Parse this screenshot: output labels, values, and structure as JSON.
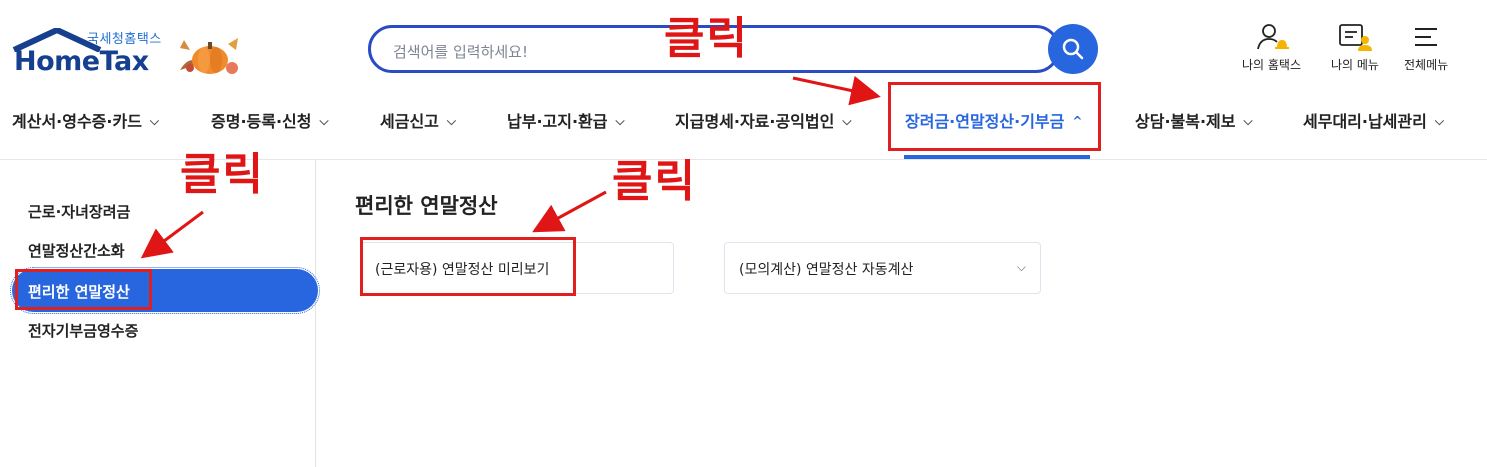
{
  "logo": {
    "sub": "국세청홈택스",
    "main": "HomeTax"
  },
  "search": {
    "placeholder": "검색어를 입력하세요!"
  },
  "util": {
    "my_hometax": "나의 홈택스",
    "my_menu": "나의 메뉴",
    "all_menu": "전체메뉴"
  },
  "nav": {
    "items": [
      {
        "label": "계산서·영수증·카드"
      },
      {
        "label": "증명·등록·신청"
      },
      {
        "label": "세금신고"
      },
      {
        "label": "납부·고지·환급"
      },
      {
        "label": "지급명세·자료·공익법인"
      },
      {
        "label": "장려금·연말정산·기부금"
      },
      {
        "label": "상담·불복·제보"
      },
      {
        "label": "세무대리·납세관리"
      }
    ],
    "chev_down": "⌵",
    "chev_up": "^"
  },
  "sidebar": {
    "items": [
      {
        "label": "근로·자녀장려금"
      },
      {
        "label": "연말정산간소화"
      },
      {
        "label": "편리한 연말정산"
      },
      {
        "label": "전자기부금영수증"
      }
    ]
  },
  "main": {
    "title": "편리한 연말정산",
    "cards": [
      {
        "label": "(근로자용) 연말정산 미리보기"
      },
      {
        "label": "(모의계산) 연말정산 자동계산"
      }
    ]
  },
  "annotations": {
    "click": "클릭"
  },
  "colors": {
    "accent": "#2866e0",
    "annotation": "#e01515",
    "logo": "#16408f"
  },
  "icons": [
    "search-icon",
    "user-bell-icon",
    "menu-person-icon",
    "hamburger-icon",
    "chevron-down-icon",
    "chevron-up-icon",
    "pumpkin-icon"
  ]
}
